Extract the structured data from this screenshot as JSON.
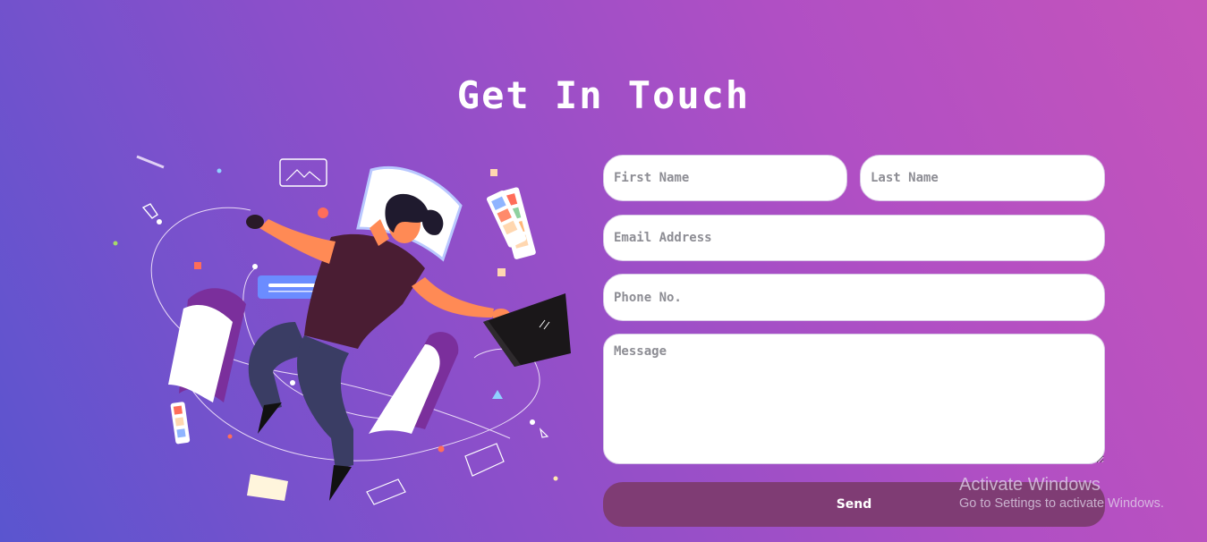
{
  "page": {
    "title": "Get In Touch"
  },
  "form": {
    "first_name": {
      "placeholder": "First Name",
      "value": ""
    },
    "last_name": {
      "placeholder": "Last Name",
      "value": ""
    },
    "email": {
      "placeholder": "Email Address",
      "value": ""
    },
    "phone": {
      "placeholder": "Phone No.",
      "value": ""
    },
    "message": {
      "placeholder": "Message",
      "value": ""
    },
    "send_label": "Send"
  },
  "watermark": {
    "title": "Activate Windows",
    "subtitle": "Go to Settings to activate Windows."
  },
  "colors": {
    "gradient_start": "#5a55cf",
    "gradient_end": "#c554bb",
    "send_button": "#7f3c74",
    "field_bg": "#ffffff"
  },
  "illustration": {
    "icon": "person-working-illustration"
  }
}
